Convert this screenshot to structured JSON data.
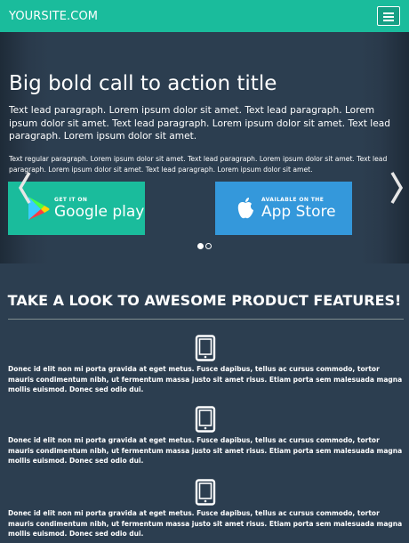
{
  "navbar": {
    "brand": "YOURSITE.COM",
    "menu_icon": "hamburger-menu-icon"
  },
  "hero": {
    "title": "Big bold call to action title",
    "lead": "Text lead paragraph. Lorem ipsum dolor sit amet. Text lead paragraph. Lorem ipsum dolor sit amet. Text lead paragraph. Lorem ipsum dolor sit amet. Text lead paragraph. Lorem ipsum dolor sit amet.",
    "text": "Text regular paragraph. Lorem ipsum dolor sit amet. Text lead paragraph. Lorem ipsum dolor sit amet. Text lead paragraph. Lorem ipsum dolor sit amet. Text lead paragraph. Lorem ipsum dolor sit amet.",
    "google": {
      "small": "GET IT ON",
      "big": "Google play",
      "icon": "google-play-icon"
    },
    "apple": {
      "small": "AVAILABLE ON THE",
      "big": "App Store",
      "icon": "apple-icon"
    },
    "slides": {
      "count": 2,
      "active": 1
    },
    "colors": {
      "google": "#1abc9c",
      "apple": "#3498db"
    }
  },
  "features": {
    "title": "TAKE A LOOK TO AWESOME PRODUCT FEATURES!",
    "items": [
      {
        "icon": "tablet-icon",
        "text": "Donec id elit non mi porta gravida at eget metus. Fusce dapibus, tellus ac cursus commodo, tortor mauris condimentum nibh, ut fermentum massa justo sit amet risus. Etiam porta sem malesuada magna mollis euismod. Donec sed odio dui."
      },
      {
        "icon": "tablet-icon",
        "text": "Donec id elit non mi porta gravida at eget metus. Fusce dapibus, tellus ac cursus commodo, tortor mauris condimentum nibh, ut fermentum massa justo sit amet risus. Etiam porta sem malesuada magna mollis euismod. Donec sed odio dui."
      },
      {
        "icon": "tablet-icon",
        "text": "Donec id elit non mi porta gravida at eget metus. Fusce dapibus, tellus ac cursus commodo, tortor mauris condimentum nibh, ut fermentum massa justo sit amet risus. Etiam porta sem malesuada magna mollis euismod. Donec sed odio dui."
      }
    ]
  },
  "colors": {
    "primary": "#1abc9c",
    "background": "#2c3e50",
    "text": "#ffffff"
  }
}
